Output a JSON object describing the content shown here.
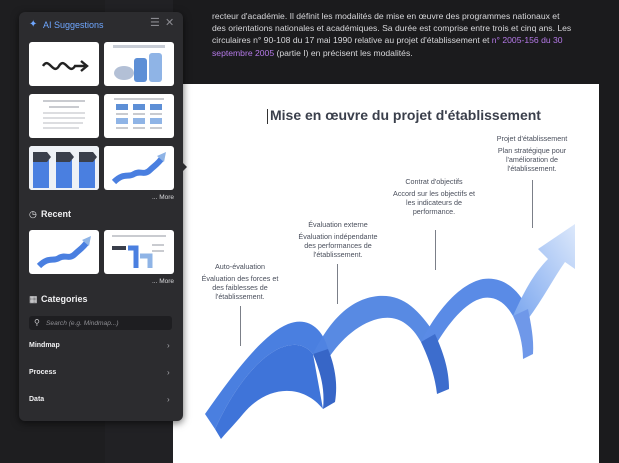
{
  "panel": {
    "title": "AI Suggestions",
    "title_icon": "sparkle-icon",
    "filter_icon": "filter-icon",
    "close_icon": "close-icon",
    "more_label": "... More",
    "recent_title": "Recent",
    "recent_icon": "history-icon",
    "categories_title": "Categories",
    "categories_icon": "grid-icon",
    "search_placeholder": "Search (e.g. Mindmap...)",
    "categories": [
      {
        "label": "Mindmap"
      },
      {
        "label": "Process"
      },
      {
        "label": "Data"
      }
    ],
    "accent": "#6fa7ff"
  },
  "document": {
    "paragraph_part1": "recteur d'académie. Il définit les modalités de mise en œuvre des programmes nationaux et des orientations nationales et académiques.  Sa durée est comprise entre trois et cinq ans. Les circulaires n° 90-108 du 17 mai 1990 relative au projet d'établissement et ",
    "paragraph_link": "n° 2005-156 du 30 septembre 2005",
    "paragraph_part2": " (partie I) en précisent les modalités.",
    "link_color": "#b579e8"
  },
  "diagram": {
    "title": "Mise en œuvre du projet d'établissement",
    "steps": [
      {
        "heading": "Auto-évaluation",
        "text": "Évaluation des forces et des faiblesses de l'établissement."
      },
      {
        "heading": "Évaluation externe",
        "text": "Évaluation indépendante des performances de l'établissement."
      },
      {
        "heading": "Contrat d'objectifs",
        "text": "Accord sur les objectifs et les indicateurs de performance."
      },
      {
        "heading": "Projet d'établissement",
        "text": "Plan stratégique pour l'amélioration de l'établissement."
      }
    ]
  }
}
